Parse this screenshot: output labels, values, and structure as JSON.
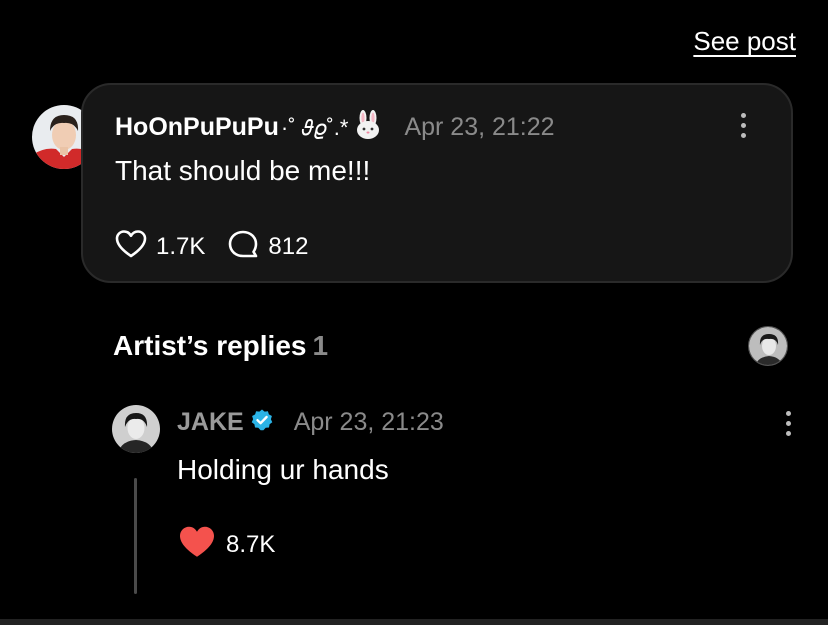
{
  "header": {
    "see_post_label": "See post"
  },
  "comment": {
    "username": "HoOnPuPuPu",
    "username_decoration": "·˚ 𝜗𝜚˚.*",
    "timestamp": "Apr 23, 21:22",
    "text": "That should be me!!!",
    "likes": "1.7K",
    "replies": "812",
    "bunny_icon": "rabbit-face-icon"
  },
  "artist_replies": {
    "title": "Artist’s replies",
    "count": "1",
    "reply": {
      "name": "JAKE",
      "verified": true,
      "timestamp": "Apr 23, 21:23",
      "text": "Holding ur hands",
      "likes": "8.7K"
    }
  },
  "colors": {
    "background": "#000000",
    "card": "#161616",
    "muted": "#8a8a8a",
    "verified": "#2bb3e6",
    "liked": "#f4524d"
  }
}
